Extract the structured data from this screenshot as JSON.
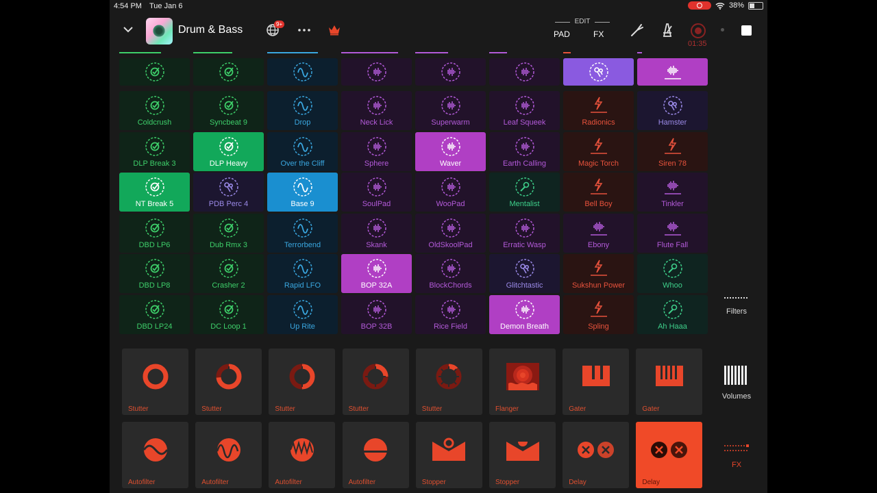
{
  "status": {
    "time": "4:54 PM",
    "date": "Tue Jan 6",
    "battery": "38%"
  },
  "toolbar": {
    "title": "Drum & Bass",
    "badge": "9+",
    "edit_label": "EDIT",
    "pad_label": "PAD",
    "fx_label": "FX",
    "rec_time": "01:35"
  },
  "colors": {
    "drums": "#4ade80",
    "bass": "#38bdf8",
    "synth": "#c084fc",
    "lead": "#f87171",
    "accent": "#b03fc4",
    "fx": "#e8462a"
  },
  "columns": [
    {
      "icon": "drum-icon",
      "color": "#3ecf6a",
      "bg": "#0f2418",
      "hdr_bg": "#0f2418",
      "active_bg": "#12a85a",
      "progress": 0.7,
      "cells": [
        {
          "label": "Coldcrush"
        },
        {
          "label": "DLP Break 3"
        },
        {
          "label": "NT Break 5",
          "active": true
        },
        {
          "label": "DBD LP6"
        },
        {
          "label": "DBD LP8"
        },
        {
          "label": "DBD LP24"
        }
      ]
    },
    {
      "icon": "drum-icon",
      "color": "#3ecf6a",
      "bg": "#0f2418",
      "hdr_bg": "#0f2418",
      "active_bg": "#12a85a",
      "progress": 0.65,
      "cells": [
        {
          "label": "Syncbeat 9"
        },
        {
          "label": "DLP Heavy",
          "active": true
        },
        {
          "label": "PDB Perc 4",
          "icon": "percussion-icon",
          "color": "#9b8ae8",
          "bg": "#1c1630"
        },
        {
          "label": "Dub Rmx 3"
        },
        {
          "label": "Crasher 2"
        },
        {
          "label": "DC Loop 1"
        }
      ]
    },
    {
      "icon": "bass-wave-icon",
      "color": "#3aa7e0",
      "bg": "#0c1f2e",
      "hdr_bg": "#0c1f2e",
      "active_bg": "#1a8fd0",
      "progress": 0.85,
      "cells": [
        {
          "label": "Drop"
        },
        {
          "label": "Over the Cliff"
        },
        {
          "label": "Base 9",
          "active": true
        },
        {
          "label": "Terrorbend"
        },
        {
          "label": "Rapid LFO"
        },
        {
          "label": "Up Rite"
        }
      ]
    },
    {
      "icon": "synth-wave-icon",
      "color": "#b35ad9",
      "bg": "#22122a",
      "hdr_bg": "#22122a",
      "active_bg": "#b03fc4",
      "progress": 0.95,
      "cells": [
        {
          "label": "Neck Lick"
        },
        {
          "label": "Sphere"
        },
        {
          "label": "SoulPad"
        },
        {
          "label": "Skank"
        },
        {
          "label": "BOP 32A",
          "active": true
        },
        {
          "label": "BOP 32B"
        }
      ]
    },
    {
      "icon": "synth-wave-icon",
      "color": "#b35ad9",
      "bg": "#22122a",
      "hdr_bg": "#22122a",
      "active_bg": "#b03fc4",
      "progress": 0.55,
      "cells": [
        {
          "label": "Superwarm"
        },
        {
          "label": "Waver",
          "active": true
        },
        {
          "label": "WooPad"
        },
        {
          "label": "OldSkoolPad"
        },
        {
          "label": "BlockChords"
        },
        {
          "label": "Rice Field"
        }
      ]
    },
    {
      "icon": "synth-wave-icon",
      "color": "#b35ad9",
      "bg": "#22122a",
      "hdr_bg": "#22122a",
      "active_bg": "#b03fc4",
      "progress": 0.3,
      "cells": [
        {
          "label": "Leaf Squeek"
        },
        {
          "label": "Earth Calling"
        },
        {
          "label": "Mentalist",
          "icon": "mic-icon",
          "color": "#3ecf8a",
          "bg": "#0f2420"
        },
        {
          "label": "Erratic Wasp"
        },
        {
          "label": "Glitchtastic",
          "icon": "percussion-icon",
          "color": "#9b8ae8",
          "bg": "#1c1630"
        },
        {
          "label": "Demon Breath",
          "active": true
        }
      ]
    },
    {
      "icon": "percussion-icon",
      "color": "#e8523c",
      "bg": "#2a1412",
      "hdr_bg": "#8a5ae0",
      "hdr_color": "#fff",
      "active_bg": "#b03fc4",
      "progress": 0.12,
      "cells": [
        {
          "label": "Radionics",
          "icon": "lead-icon"
        },
        {
          "label": "Magic Torch",
          "icon": "lead-icon"
        },
        {
          "label": "Bell Boy",
          "icon": "lead-icon"
        },
        {
          "label": "Ebony",
          "icon": "synth-bars-icon",
          "color": "#b35ad9",
          "bg": "#22122a"
        },
        {
          "label": "Sukshun Power",
          "icon": "lead-icon"
        },
        {
          "label": "Spling",
          "icon": "lead-icon"
        }
      ]
    },
    {
      "icon": "synth-bars-icon",
      "color": "#b35ad9",
      "bg": "#22122a",
      "hdr_bg": "#b03fc4",
      "hdr_color": "#fff",
      "active_bg": "#b03fc4",
      "progress": 0.08,
      "cells": [
        {
          "label": "Hamster",
          "icon": "percussion-icon",
          "color": "#9b8ae8",
          "bg": "#1c1630"
        },
        {
          "label": "Siren 78",
          "icon": "lead-icon",
          "color": "#e8523c",
          "bg": "#2a1412"
        },
        {
          "label": "Tinkler",
          "icon": "synth-bars-icon"
        },
        {
          "label": "Flute Fall",
          "icon": "synth-bars-icon"
        },
        {
          "label": "Whoo",
          "icon": "mic-icon",
          "color": "#3ecf8a",
          "bg": "#0f2420"
        },
        {
          "label": "Ah Haaa",
          "icon": "mic-icon",
          "color": "#3ecf8a",
          "bg": "#0f2420"
        }
      ]
    }
  ],
  "fx_row1": [
    {
      "label": "Stutter",
      "icon": "stutter-full-icon"
    },
    {
      "label": "Stutter",
      "icon": "stutter-three-quarter-icon"
    },
    {
      "label": "Stutter",
      "icon": "stutter-half-icon"
    },
    {
      "label": "Stutter",
      "icon": "stutter-quarter-icon"
    },
    {
      "label": "Stutter",
      "icon": "stutter-eighth-icon"
    },
    {
      "label": "Flanger",
      "icon": "flanger-icon"
    },
    {
      "label": "Gater",
      "icon": "gater-icon"
    },
    {
      "label": "Gater",
      "icon": "gater-fast-icon"
    }
  ],
  "fx_row2": [
    {
      "label": "Autofilter",
      "icon": "autofilter-low-icon"
    },
    {
      "label": "Autofilter",
      "icon": "autofilter-mid-icon"
    },
    {
      "label": "Autofilter",
      "icon": "autofilter-high-icon"
    },
    {
      "label": "Autofilter",
      "icon": "autofilter-half-icon"
    },
    {
      "label": "Stopper",
      "icon": "stopper-icon"
    },
    {
      "label": "Stopper",
      "icon": "stopper-alt-icon"
    },
    {
      "label": "Delay",
      "icon": "delay-icon"
    },
    {
      "label": "Delay",
      "icon": "delay-icon",
      "active": true
    }
  ],
  "side": {
    "filters": "Filters",
    "volumes": "Volumes",
    "fx": "FX"
  }
}
